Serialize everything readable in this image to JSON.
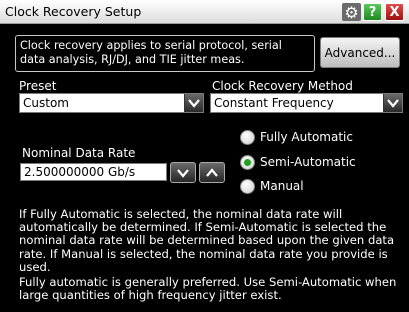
{
  "window": {
    "title": "Clock Recovery Setup",
    "help_label": "?",
    "close_label": "X"
  },
  "info": {
    "text": "Clock recovery applies to serial protocol, serial data analysis, RJ/DJ, and TIE jitter meas."
  },
  "advanced_button": "Advanced...",
  "preset": {
    "label": "Preset",
    "value": "Custom"
  },
  "method": {
    "label": "Clock Recovery Method",
    "value": "Constant Frequency"
  },
  "rate": {
    "label": "Nominal Data Rate",
    "value": "2.500000000 Gb/s"
  },
  "modes": [
    {
      "label": "Fully Automatic",
      "selected": false
    },
    {
      "label": "Semi-Automatic",
      "selected": true
    },
    {
      "label": "Manual",
      "selected": false
    }
  ],
  "help_text": {
    "p1": "If Fully Automatic is selected, the nominal data rate will automatically be determined. If Semi-Automatic is selected the nominal data rate will be determined based upon the given data rate. If Manual is selected, the nominal data rate you provide is used.",
    "p2": "Fully automatic is generally preferred. Use Semi-Automatic when large quantities of high frequency jitter exist."
  },
  "colors": {
    "background": "#000000",
    "selected_radio": "#1fa01f",
    "help_button": "#2ea82e",
    "close_button": "#c02020"
  }
}
